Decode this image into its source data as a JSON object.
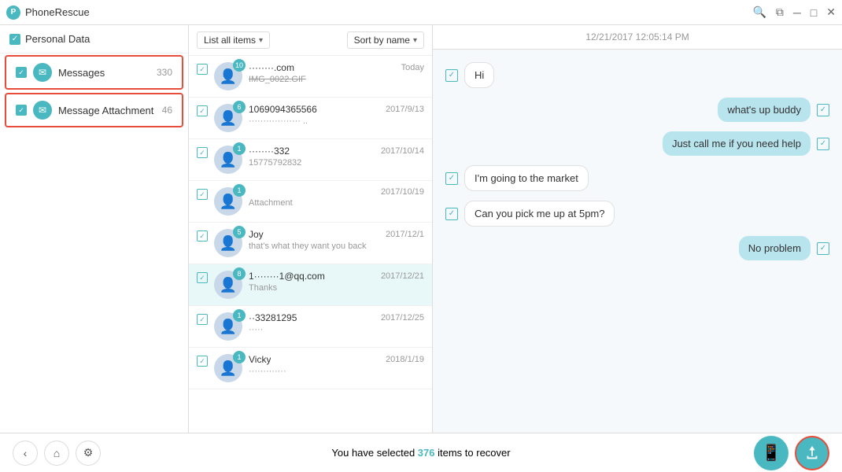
{
  "app": {
    "name": "PhoneRescue",
    "logo_letter": "P"
  },
  "titlebar": {
    "title": "PhoneRescue",
    "buttons": [
      "search",
      "restore",
      "minimize",
      "maximize",
      "close"
    ]
  },
  "sidebar": {
    "header_label": "Personal Data",
    "items": [
      {
        "label": "Messages",
        "count": "330",
        "icon": "💬",
        "checked": true
      },
      {
        "label": "Message Attachment",
        "count": "46",
        "icon": "💬",
        "checked": true
      }
    ]
  },
  "middle": {
    "filter_label": "List all items",
    "sort_label": "Sort by name",
    "items": [
      {
        "badge": "10",
        "name": "········.com",
        "name_strikethrough": "IMG_0022.GIF",
        "date": "Today",
        "preview": ""
      },
      {
        "badge": "6",
        "name": "1069094365566",
        "date": "2017/9/13",
        "preview": "·················· .."
      },
      {
        "badge": "1",
        "name": "········332",
        "date": "2017/10/14",
        "preview": "15775792832"
      },
      {
        "badge": "1",
        "name": "",
        "date": "2017/10/19",
        "preview": "Attachment"
      },
      {
        "badge": "5",
        "name": "Joy",
        "date": "2017/12/1",
        "preview": "that's what they want you back"
      },
      {
        "badge": "8",
        "name": "1········1@qq.com",
        "date": "2017/12/21",
        "preview": "Thanks",
        "selected": true
      },
      {
        "badge": "1",
        "name": "··33281295",
        "date": "2017/12/25",
        "preview": "·····"
      },
      {
        "badge": "1",
        "name": "Vicky",
        "date": "2018/1/19",
        "preview": "·············"
      }
    ]
  },
  "chat": {
    "timestamp": "12/21/2017 12:05:14 PM",
    "messages": [
      {
        "type": "received",
        "text": "Hi",
        "checked": true
      },
      {
        "type": "sent",
        "text": "what's up buddy",
        "checked": true
      },
      {
        "type": "sent",
        "text": "Just call me if you need help",
        "checked": true
      },
      {
        "type": "received",
        "text": "I'm going to the market",
        "checked": true
      },
      {
        "type": "received",
        "text": "Can you pick me up at 5pm?",
        "checked": true
      },
      {
        "type": "sent",
        "text": "No problem",
        "checked": true
      }
    ]
  },
  "bottom": {
    "text_prefix": "You have selected ",
    "count": "376",
    "text_suffix": " items to recover"
  },
  "icons": {
    "search": "🔍",
    "restore": "⧉",
    "minimize": "─",
    "maximize": "□",
    "close": "✕",
    "checkmark": "✓",
    "arrow_left": "‹",
    "home": "⌂",
    "settings": "⚙",
    "phone": "📱",
    "export": "⬆"
  }
}
